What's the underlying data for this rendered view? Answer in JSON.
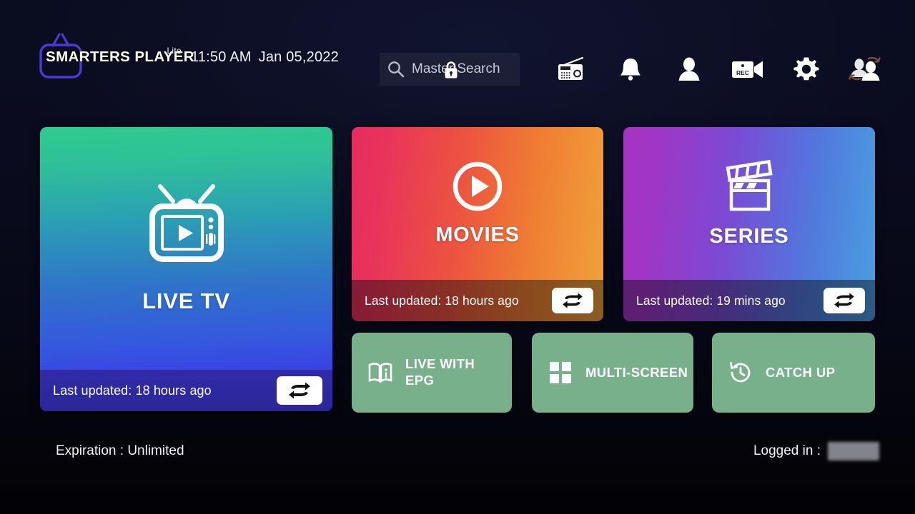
{
  "app": {
    "logo_text": "SMARTERS PLAYER",
    "logo_sub": "Lite",
    "logo_icon": "tv-outline-icon"
  },
  "header": {
    "time": "11:50 AM",
    "date": "Jan 05,2022",
    "search": {
      "placeholder": "Master Search",
      "value": "Master Search",
      "icon": "search-icon",
      "lock_icon": "lock-icon"
    },
    "icons": [
      {
        "name": "radio-icon",
        "label": "Radio"
      },
      {
        "name": "bell-icon",
        "label": "Notifications"
      },
      {
        "name": "person-icon",
        "label": "Account"
      },
      {
        "name": "rec-camera-icon",
        "label": "REC"
      },
      {
        "name": "gear-icon",
        "label": "Settings"
      },
      {
        "name": "switch-user-icon",
        "label": "Switch User"
      }
    ],
    "rec_label": "REC"
  },
  "main": {
    "cards": [
      {
        "id": "live-tv",
        "title": "LIVE TV",
        "icon": "tv-play-icon",
        "footer": "Last updated: 18 hours ago",
        "refresh_icon": "refresh-loop-icon",
        "gradient_from": "#2ecc8f",
        "gradient_to": "#3a2fd8"
      },
      {
        "id": "movies",
        "title": "MOVIES",
        "icon": "play-circle-icon",
        "footer": "Last updated: 18 hours ago",
        "refresh_icon": "refresh-loop-icon",
        "gradient_from": "#e62d5e",
        "gradient_to": "#f0a23a"
      },
      {
        "id": "series",
        "title": "SERIES",
        "icon": "clapperboard-icon",
        "footer": "Last updated: 19 mins ago",
        "refresh_icon": "refresh-loop-icon",
        "gradient_from": "#a734c2",
        "gradient_to": "#4a9fe0"
      }
    ],
    "tiles": [
      {
        "id": "live-with-epg",
        "label": "LIVE WITH EPG",
        "icon": "book-info-icon",
        "color": "#77b08b"
      },
      {
        "id": "multi-screen",
        "label": "MULTI-SCREEN",
        "icon": "grid-four-icon",
        "color": "#77b08b"
      },
      {
        "id": "catch-up",
        "label": "CATCH UP",
        "icon": "clock-rewind-icon",
        "color": "#77b08b"
      }
    ]
  },
  "status": {
    "expiration": "Expiration : Unlimited",
    "logged_in_label": "Logged in :",
    "logged_in_value": ""
  }
}
